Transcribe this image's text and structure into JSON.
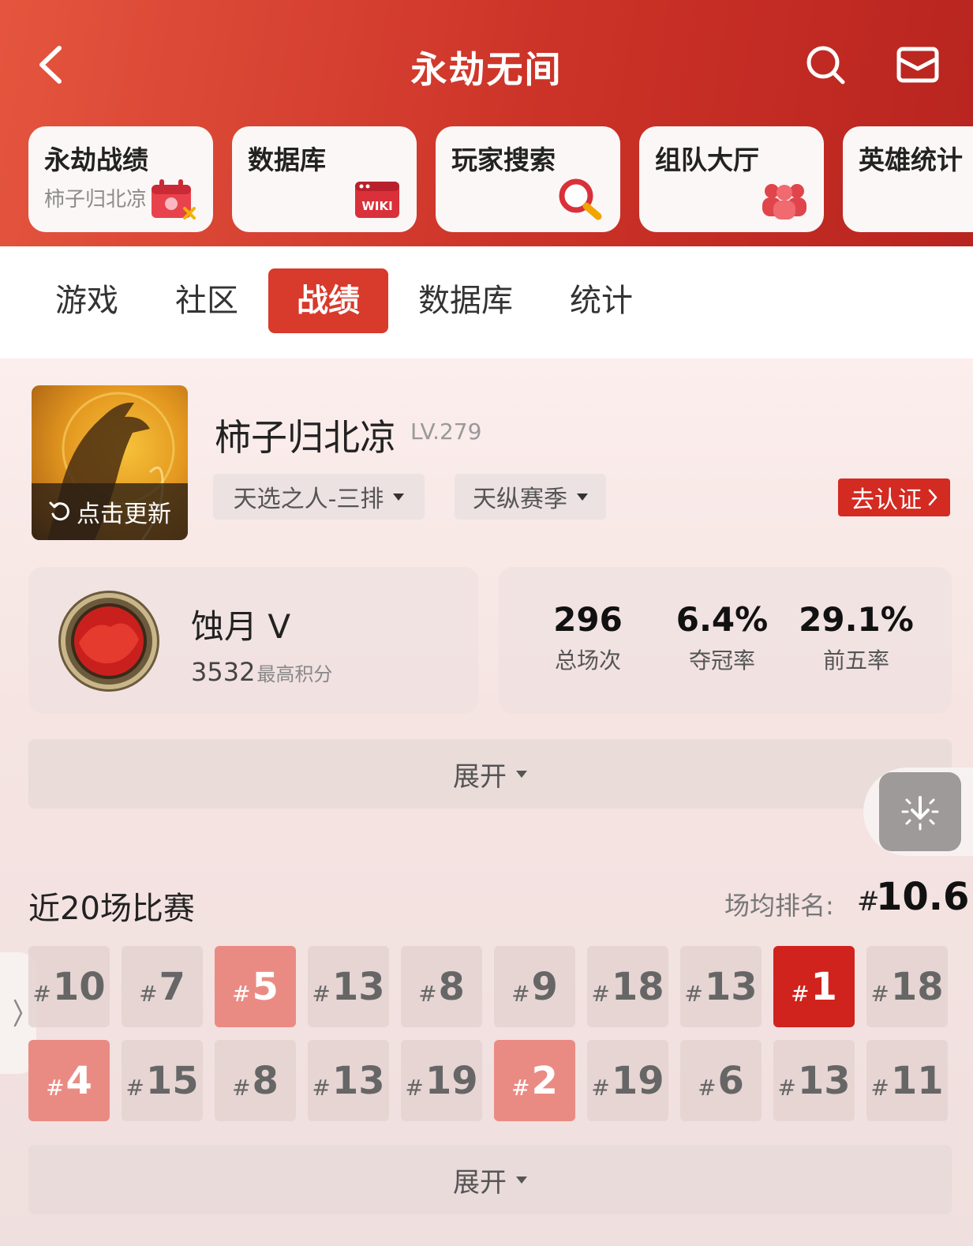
{
  "header": {
    "title": "永劫无间",
    "icons": {
      "back": "back-arrow-icon",
      "search": "search-icon",
      "mail": "mail-icon"
    },
    "shortcuts": [
      {
        "title": "永劫战绩",
        "subtitle": "柿子归北凉",
        "icon": "calendar-badge-icon"
      },
      {
        "title": "数据库",
        "subtitle": "",
        "icon": "wiki-icon",
        "icon_text": "WIKI"
      },
      {
        "title": "玩家搜索",
        "subtitle": "",
        "icon": "magnifier-icon"
      },
      {
        "title": "组队大厅",
        "subtitle": "",
        "icon": "group-icon"
      },
      {
        "title": "英雄统计",
        "subtitle": "",
        "icon": "hero-stats-icon"
      }
    ]
  },
  "tabs": [
    "游戏",
    "社区",
    "战绩",
    "数据库",
    "统计"
  ],
  "active_tab": "战绩",
  "player": {
    "name": "柿子归北凉",
    "level": "LV.279",
    "update_label": "点击更新",
    "mode_filter": "天选之人-三排",
    "season_filter": "天纵赛季",
    "verify_label": "去认证"
  },
  "rank": {
    "name": "蚀月 V",
    "score": "3532",
    "score_label": "最高积分"
  },
  "stats": [
    {
      "value": "296",
      "label": "总场次"
    },
    {
      "value": "6.4%",
      "label": "夺冠率"
    },
    {
      "value": "29.1%",
      "label": "前五率"
    }
  ],
  "expand_label": "展开",
  "recent": {
    "title": "近20场比赛",
    "avg_label": "场均排名:",
    "avg_hash": "#",
    "avg_value": "10.6",
    "matches": [
      "10",
      "7",
      "5",
      "13",
      "8",
      "9",
      "18",
      "13",
      "1",
      "18",
      "4",
      "15",
      "8",
      "13",
      "19",
      "2",
      "19",
      "6",
      "13",
      "11"
    ]
  },
  "colors": {
    "header_red": "#cc3328",
    "accent_red": "#d0231d",
    "top5_pink": "#ea8b83"
  }
}
